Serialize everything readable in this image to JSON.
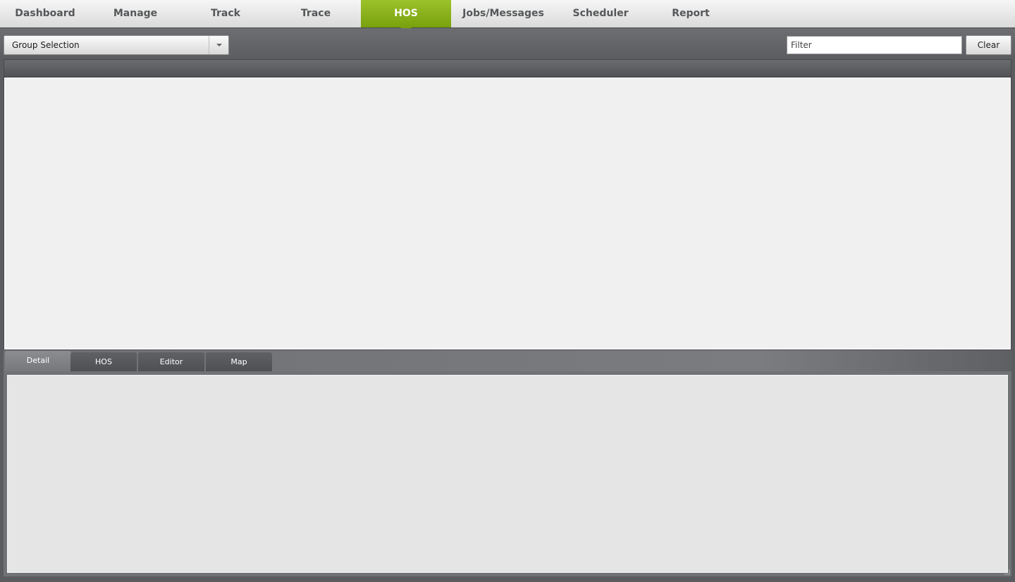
{
  "nav": {
    "items": [
      {
        "label": "Dashboard"
      },
      {
        "label": "Manage"
      },
      {
        "label": "Track"
      },
      {
        "label": "Trace"
      },
      {
        "label": "HOS"
      },
      {
        "label": "Jobs/Messages"
      },
      {
        "label": "Scheduler"
      },
      {
        "label": "Report"
      }
    ],
    "active": "HOS",
    "accent_color": "#8db51c"
  },
  "toolbar": {
    "group_selection_label": "Group Selection",
    "filter_placeholder": "Filter",
    "filter_value": "",
    "clear_label": "Clear"
  },
  "bottom_tabs": {
    "items": [
      {
        "label": "Detail"
      },
      {
        "label": "HOS"
      },
      {
        "label": "Editor"
      },
      {
        "label": "Map"
      }
    ],
    "active": "Detail"
  },
  "icons": {
    "dropdown": "chevron-down-icon",
    "resize": "resize-grip-icon"
  }
}
